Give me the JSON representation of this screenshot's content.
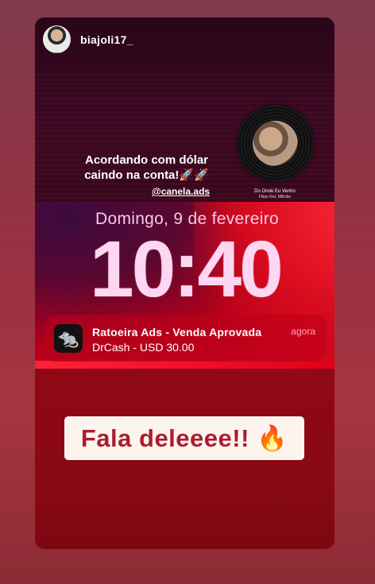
{
  "story": {
    "username": "biajoli17_",
    "caption": "Acordando com dólar caindo na conta!🚀🚀",
    "mention": "@canela.ads",
    "music": {
      "title": "Do Onde Eu Venho",
      "artist": "Filipe Ret, MBzike"
    }
  },
  "lockscreen": {
    "date": "Domingo, 9 de fevereiro",
    "time": "10:40",
    "notification": {
      "icon": "rat-app-icon",
      "title": "Ratoeira Ads - Venda Aprovada",
      "body": "DrCash - USD 30.00",
      "time": "agora"
    }
  },
  "sticker": {
    "text": "Fala deleeee!! 🔥"
  }
}
